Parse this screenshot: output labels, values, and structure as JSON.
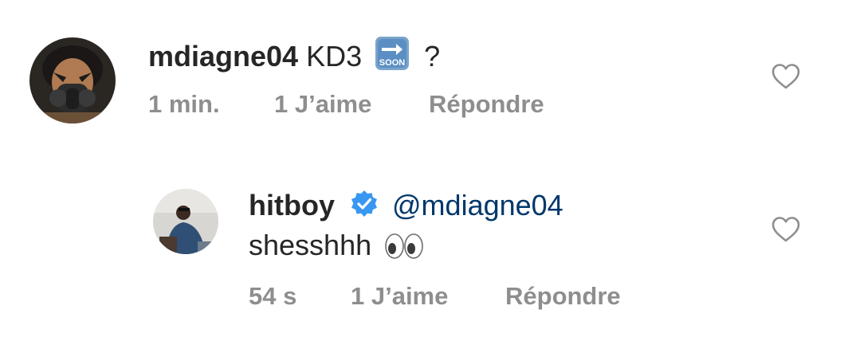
{
  "comments": [
    {
      "username": "mdiagne04",
      "text": "KD3",
      "emoji": "soon-arrow-emoji",
      "text_after": "?",
      "time": "1 min.",
      "likes": "1 J’aime",
      "reply": "Répondre"
    }
  ],
  "reply_comment": {
    "username": "hitboy",
    "verified": true,
    "mention": "@mdiagne04",
    "text": "shesshhh",
    "emoji": "eyes-emoji",
    "time": "54 s",
    "likes": "1 J’aime",
    "reply": "Répondre"
  },
  "colors": {
    "text": "#262626",
    "meta": "#8e8e8e",
    "mention": "#00376b",
    "verified": "#3897f0"
  }
}
